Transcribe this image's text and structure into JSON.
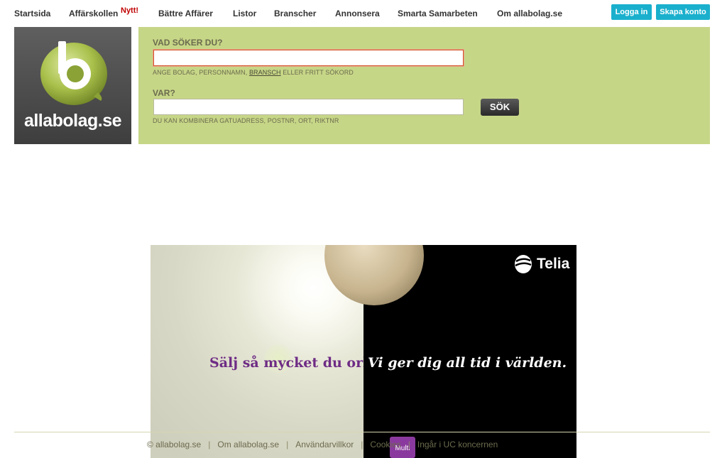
{
  "nav": {
    "items": [
      {
        "label": "Startsida"
      },
      {
        "label": "Affärskollen",
        "badge": "Nytt!"
      },
      {
        "label": "Bättre Affärer"
      },
      {
        "label": "Listor"
      },
      {
        "label": "Branscher"
      },
      {
        "label": "Annonsera"
      },
      {
        "label": "Smarta Samarbeten"
      },
      {
        "label": "Om allabolag.se"
      }
    ],
    "login_label": "Logga in",
    "signup_label": "Skapa konto"
  },
  "logo": {
    "wordmark": "allabolag.se",
    "letter": "b"
  },
  "search": {
    "what_label": "VAD SÖKER DU?",
    "what_value": "",
    "what_help_prefix": "ANGE BOLAG, PERSONNAMN, ",
    "what_help_link": "BRANSCH",
    "what_help_suffix": " ELLER FRITT SÖKORD",
    "where_label": "VAR?",
    "where_value": "",
    "where_help": "DU KAN KOMBINERA GATUADRESS, POSTNR, ORT, RIKTNR",
    "button_label": "SÖK"
  },
  "ad": {
    "left_headline": "Sälj så mycket du orkar.",
    "right_headline": "Vi ger dig all tid i världen.",
    "brand": "Telia",
    "badge": "Multi"
  },
  "footer": {
    "copyright": "© allabolag.se",
    "about": "Om allabolag.se",
    "terms": "Användarvillkor",
    "cookies": "Cookies",
    "group": "Ingår i UC koncernen"
  },
  "colors": {
    "panel": "#c6d687",
    "accent_button": "#1ab0cd",
    "new_badge": "#c00000"
  }
}
